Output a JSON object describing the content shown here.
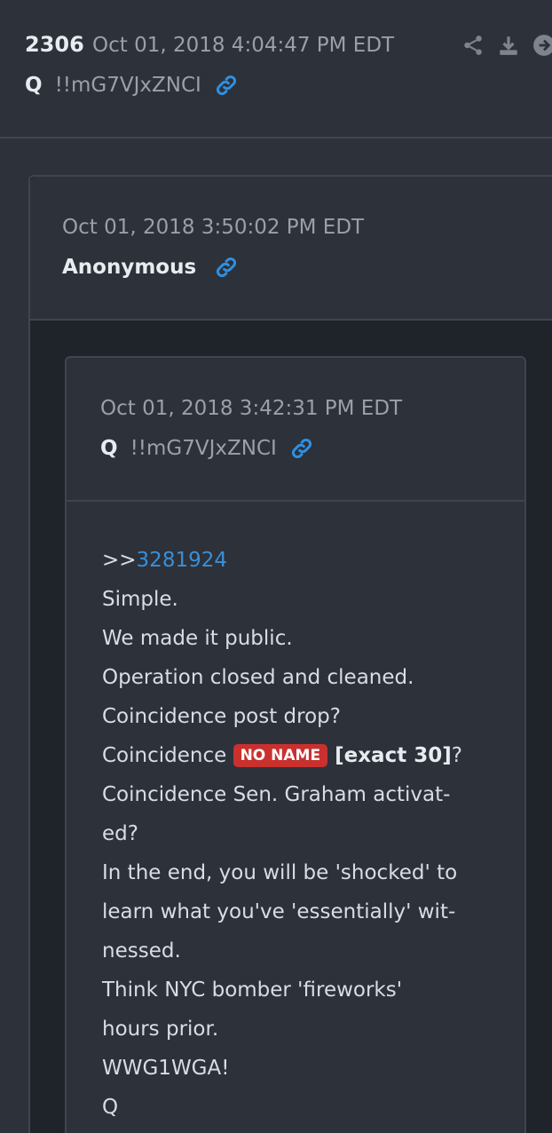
{
  "post": {
    "number": "2306",
    "date": "Oct 01, 2018 4:04:47 PM EDT",
    "author": "Q",
    "tripcode": "!!mG7VJxZNCI",
    "actions": [
      "share-icon",
      "download-icon",
      "next-icon"
    ]
  },
  "outer_quote": {
    "date": "Oct 01, 2018 3:50:02 PM EDT",
    "author": "Anonymous"
  },
  "inner_quote": {
    "date": "Oct 01, 2018 3:42:31 PM EDT",
    "author": "Q",
    "tripcode": "!!mG7VJxZNCI",
    "reply_prefix": ">>",
    "reply_id": "3281924",
    "lines": [
      "Simple.",
      "We made it public.",
      "Operation closed and cleaned.",
      "Coincidence post drop?"
    ],
    "badge_line": {
      "before": "Coincidence ",
      "badge": "NO NAME",
      "bold": " [exact 30]",
      "after": "?"
    },
    "lines_after": [
      "Coincidence Sen. Graham activat-",
      "ed?",
      "In the end, you will be 'shocked' to",
      "learn what you've 'essentially' wit-",
      "nessed.",
      "Think NYC bomber 'fireworks'",
      "hours prior.",
      "WWG1WGA!",
      "Q"
    ]
  },
  "colors": {
    "background": "#2c313a",
    "inner_background": "#1f242b",
    "link": "#3a8fd6",
    "badge": "#c8312e"
  }
}
